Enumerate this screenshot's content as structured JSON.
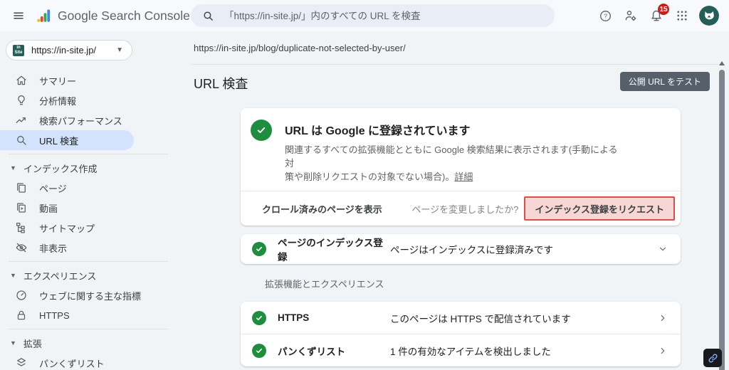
{
  "colors": {
    "green": "#1e8e3e",
    "selected-blue": "#d3e3fd",
    "badge-red": "#c5221f",
    "dark-button": "#57606a",
    "hl-red": "#df4e46",
    "hl-red-bg": "#f6d7d5",
    "avatar-teal": "#275d57"
  },
  "topbar": {
    "app_title": "Google Search Console",
    "search_placeholder": "「https://in-site.jp/」内のすべての URL を検査",
    "notification_count": "15"
  },
  "sidebar": {
    "property_label": "https://in-site.jp/",
    "items": [
      {
        "type": "item",
        "id": "summary",
        "icon": "home",
        "label": "サマリー"
      },
      {
        "type": "item",
        "id": "insights",
        "icon": "lightbulb",
        "label": "分析情報"
      },
      {
        "type": "item",
        "id": "performance",
        "icon": "trending",
        "label": "検索パフォーマンス"
      },
      {
        "type": "item",
        "id": "url-inspection",
        "icon": "search",
        "label": "URL 検査",
        "selected": true
      },
      {
        "type": "divider"
      },
      {
        "type": "section",
        "id": "indexing",
        "label": "インデックス作成"
      },
      {
        "type": "item",
        "id": "pages",
        "icon": "pages",
        "label": "ページ"
      },
      {
        "type": "item",
        "id": "videos",
        "icon": "video",
        "label": "動画"
      },
      {
        "type": "item",
        "id": "sitemaps",
        "icon": "sitemap",
        "label": "サイトマップ"
      },
      {
        "type": "item",
        "id": "removals",
        "icon": "eye-off",
        "label": "非表示"
      },
      {
        "type": "divider"
      },
      {
        "type": "section",
        "id": "experience",
        "label": "エクスペリエンス"
      },
      {
        "type": "item",
        "id": "core-web-vitals",
        "icon": "gauge",
        "label": "ウェブに関する主な指標"
      },
      {
        "type": "item",
        "id": "https",
        "icon": "lock",
        "label": "HTTPS"
      },
      {
        "type": "divider"
      },
      {
        "type": "section",
        "id": "enhancements",
        "label": "拡張"
      },
      {
        "type": "item",
        "id": "breadcrumbs",
        "icon": "layers",
        "label": "パンくずリスト"
      }
    ]
  },
  "content": {
    "inspected_url": "https://in-site.jp/blog/duplicate-not-selected-by-user/",
    "page_title": "URL 検査",
    "test_live_button": "公開 URL をテスト",
    "verdict": {
      "title": "URL は Google に登録されています",
      "description_line1": "関連するすべての拡張機能とともに Google 検索結果に表示されます(手動による対",
      "description_line2": "策や削除リクエストの対象でない場合)。",
      "learn_more": "詳細",
      "view_crawled_page": "クロール済みのページを表示",
      "changed_question": "ページを変更しましたか?",
      "request_indexing": "インデックス登録をリクエスト"
    },
    "indexing_card": {
      "label": "ページのインデックス登録",
      "status": "ページはインデックスに登録済みです"
    },
    "section_label": "拡張機能とエクスペリエンス",
    "enhancements": [
      {
        "id": "https",
        "label": "HTTPS",
        "status": "このページは HTTPS で配信されています"
      },
      {
        "id": "breadcrumbs",
        "label": "パンくずリスト",
        "status": "1 件の有効なアイテムを検出しました"
      }
    ]
  }
}
